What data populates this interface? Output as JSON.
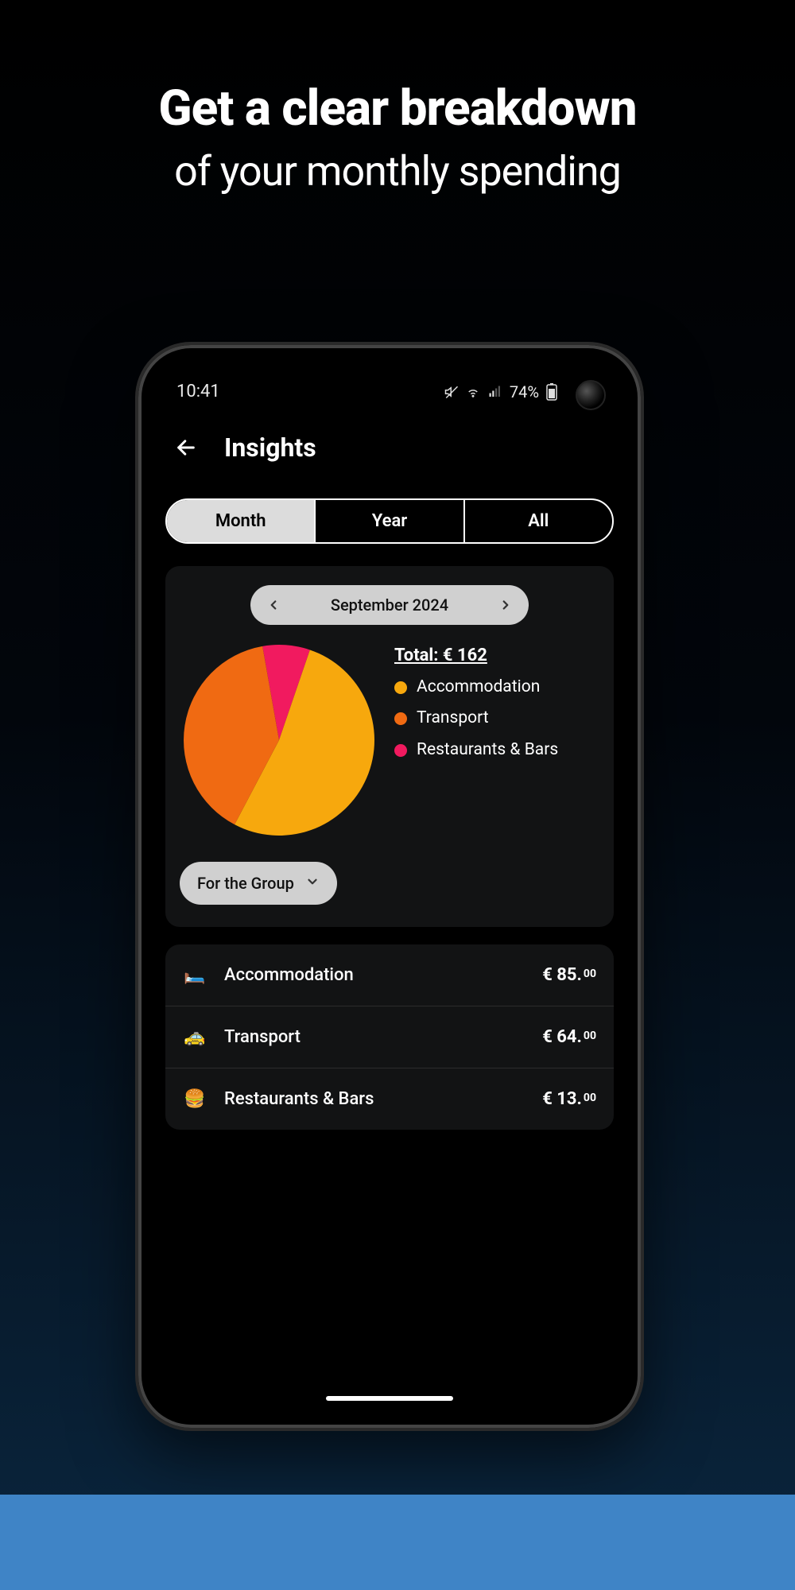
{
  "hero": {
    "line1": "Get a clear breakdown",
    "line2": "of your monthly spending"
  },
  "status": {
    "time": "10:41",
    "battery_text": "74%"
  },
  "header": {
    "title": "Insights"
  },
  "segmented": {
    "items": [
      "Month",
      "Year",
      "All"
    ],
    "active_index": 0
  },
  "period": {
    "label": "September 2024"
  },
  "chart_data": {
    "type": "pie",
    "title": "Total: € 162",
    "series": [
      {
        "name": "Accommodation",
        "value": 85,
        "color": "#f7a80d"
      },
      {
        "name": "Transport",
        "value": 64,
        "color": "#f06a12"
      },
      {
        "name": "Restaurants & Bars",
        "value": 13,
        "color": "#f11a5f"
      }
    ],
    "total_label": "Total: € 162",
    "currency": "€",
    "total_value": 162
  },
  "scope": {
    "label": "For the Group"
  },
  "list": {
    "rows": [
      {
        "icon": "🛏️",
        "label": "Accommodation",
        "amount_major": "€ 85.",
        "amount_minor": "00"
      },
      {
        "icon": "🚕",
        "label": "Transport",
        "amount_major": "€ 64.",
        "amount_minor": "00"
      },
      {
        "icon": "🍔",
        "label": "Restaurants & Bars",
        "amount_major": "€ 13.",
        "amount_minor": "00"
      }
    ]
  }
}
